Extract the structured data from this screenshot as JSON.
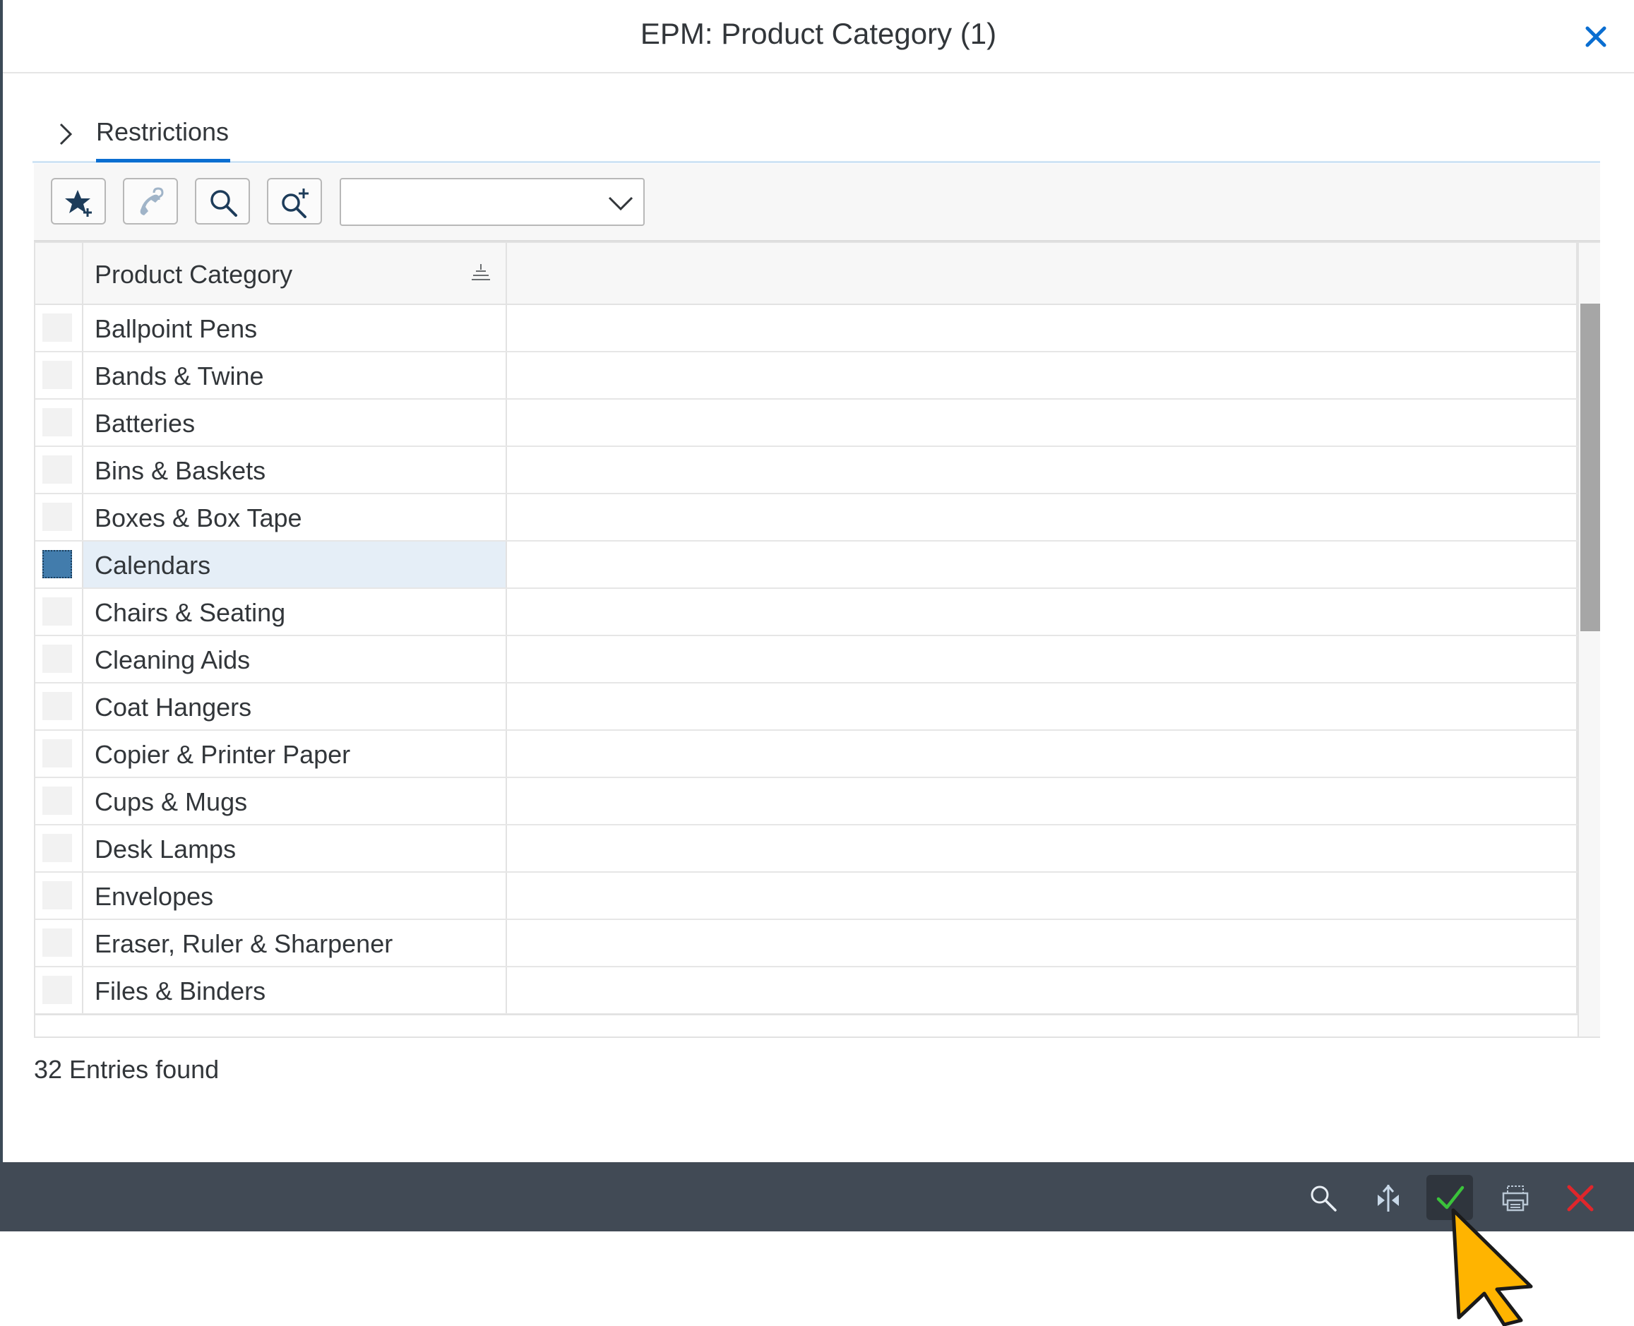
{
  "dialog": {
    "title": "EPM: Product Category (1)",
    "close_icon": "close-icon"
  },
  "restrictions": {
    "label": "Restrictions",
    "icon": "chevron-right-icon"
  },
  "toolbar": {
    "buttons": [
      {
        "name": "add-favorite",
        "icon": "star-plus-icon"
      },
      {
        "name": "personal-value-list",
        "icon": "phone-help-icon"
      },
      {
        "name": "search",
        "icon": "search-icon"
      },
      {
        "name": "search-more",
        "icon": "search-plus-icon"
      }
    ],
    "select_value": ""
  },
  "table": {
    "column_header": "Product Category",
    "rows": [
      {
        "label": "Ballpoint Pens",
        "selected": false
      },
      {
        "label": "Bands & Twine",
        "selected": false
      },
      {
        "label": "Batteries",
        "selected": false
      },
      {
        "label": "Bins & Baskets",
        "selected": false
      },
      {
        "label": "Boxes & Box Tape",
        "selected": false
      },
      {
        "label": "Calendars",
        "selected": true
      },
      {
        "label": "Chairs & Seating",
        "selected": false
      },
      {
        "label": "Cleaning Aids",
        "selected": false
      },
      {
        "label": "Coat Hangers",
        "selected": false
      },
      {
        "label": "Copier & Printer Paper",
        "selected": false
      },
      {
        "label": "Cups & Mugs",
        "selected": false
      },
      {
        "label": "Desk Lamps",
        "selected": false
      },
      {
        "label": "Envelopes",
        "selected": false
      },
      {
        "label": "Eraser, Ruler & Sharpener",
        "selected": false
      },
      {
        "label": "Files & Binders",
        "selected": false
      }
    ]
  },
  "status": {
    "entries_found": "32 Entries found"
  },
  "footer": {
    "buttons": [
      {
        "name": "search",
        "icon": "search-icon"
      },
      {
        "name": "navigate",
        "icon": "navigate-icon"
      },
      {
        "name": "confirm",
        "icon": "checkmark-icon"
      },
      {
        "name": "print",
        "icon": "print-icon"
      },
      {
        "name": "cancel",
        "icon": "cancel-x-icon"
      }
    ]
  },
  "colors": {
    "accent": "#0a6ed1",
    "selected_row": "#e5eef7",
    "footer_bg": "#414a55",
    "confirm_green": "#3bc33b",
    "cancel_red": "#e0262b",
    "cursor_yellow": "#ffb400"
  }
}
